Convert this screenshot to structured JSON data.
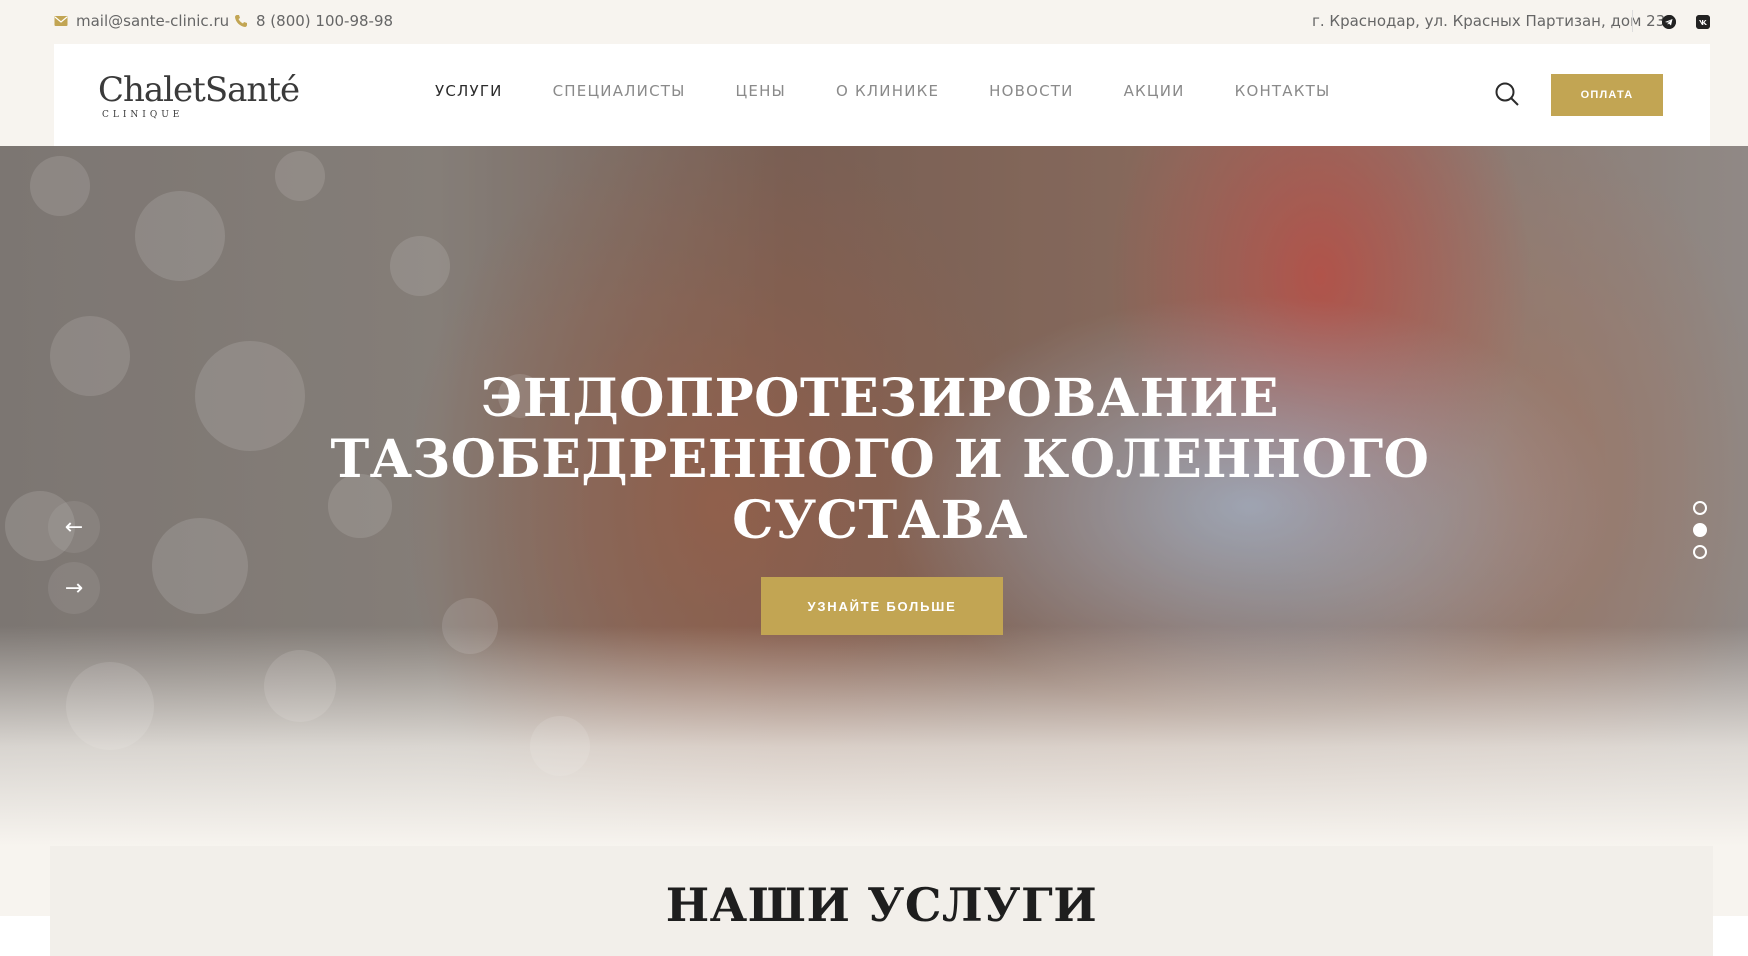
{
  "topbar": {
    "email": "mail@sante-clinic.ru",
    "phone": "8 (800) 100-98-98",
    "address": "г. Краснодар, ул. Красных Партизан, дом 238",
    "socials": [
      "telegram-icon",
      "vk-icon"
    ]
  },
  "header": {
    "logo_text": "ChaletSanté",
    "logo_sub": "CLINIQUE",
    "nav": [
      {
        "label": "УСЛУГИ",
        "active": true
      },
      {
        "label": "СПЕЦИАЛИСТЫ",
        "active": false
      },
      {
        "label": "ЦЕНЫ",
        "active": false
      },
      {
        "label": "О КЛИНИКЕ",
        "active": false
      },
      {
        "label": "НОВОСТИ",
        "active": false
      },
      {
        "label": "АКЦИИ",
        "active": false
      },
      {
        "label": "КОНТАКТЫ",
        "active": false
      }
    ],
    "pay_label": "ОПЛАТА"
  },
  "hero": {
    "title_lines": [
      "ЭНДОПРОТЕЗИРОВАНИЕ",
      "ТАЗОБЕДРЕННОГО И КОЛЕННОГО",
      "СУСТАВА"
    ],
    "button_label": "УЗНАЙТЕ БОЛЬШЕ",
    "prev_arrow": "←",
    "next_arrow": "→",
    "slides_total": 3,
    "active_slide": 2
  },
  "services": {
    "title": "НАШИ УСЛУГИ"
  },
  "colors": {
    "accent": "#c2a553",
    "background": "#f7f4ef",
    "text_dark": "#2b2b2b",
    "nav_inactive": "#8a8a8a"
  }
}
